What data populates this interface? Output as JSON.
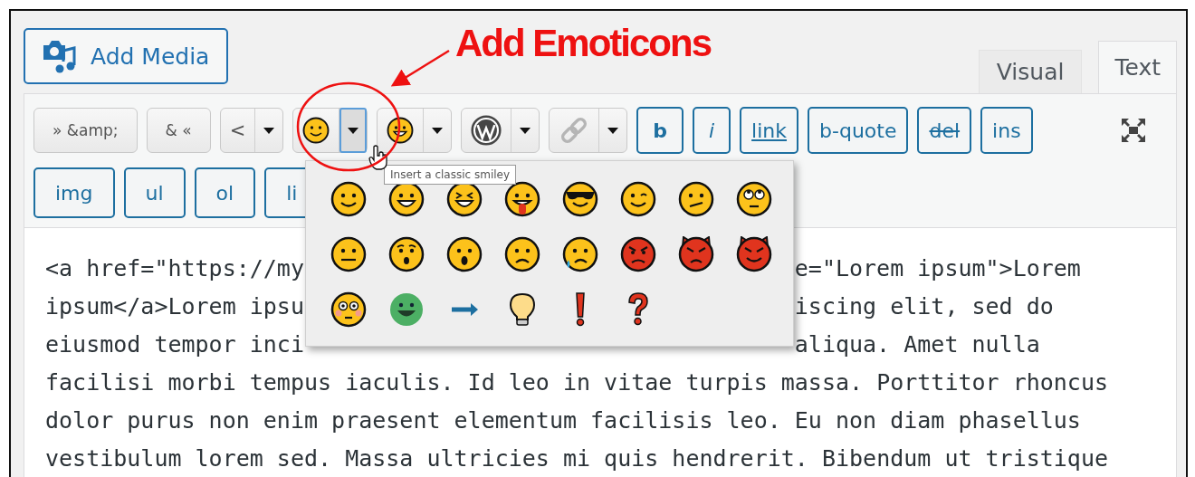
{
  "annotation": {
    "text": "Add Emoticons"
  },
  "add_media": {
    "label": "Add Media"
  },
  "tabs": [
    {
      "label": "Visual",
      "selected": false
    },
    {
      "label": "Text",
      "selected": true
    }
  ],
  "toolbar": {
    "row_1": [
      {
        "kind": "text",
        "label": "» &amp;"
      },
      {
        "kind": "text",
        "label": "& «"
      },
      {
        "kind": "split",
        "label": "<",
        "caret_active": false
      },
      {
        "kind": "smiley",
        "caret_active": true
      },
      {
        "kind": "grin",
        "caret_active": false
      },
      {
        "kind": "wp",
        "caret_active": false
      },
      {
        "kind": "chain",
        "caret_active": false
      },
      {
        "kind": "bold",
        "label": "b"
      },
      {
        "kind": "italic",
        "label": "i"
      },
      {
        "kind": "underline",
        "label": "link"
      },
      {
        "kind": "tag",
        "label": "b-quote"
      },
      {
        "kind": "strike",
        "label": "del"
      },
      {
        "kind": "tag",
        "label": "ins"
      }
    ],
    "row_2": [
      {
        "label": "img"
      },
      {
        "label": "ul"
      },
      {
        "label": "ol"
      },
      {
        "label": "li"
      }
    ]
  },
  "tooltip": "Insert a classic smiley",
  "smilies": [
    {
      "kind": "smile"
    },
    {
      "kind": "grin"
    },
    {
      "kind": "laugh"
    },
    {
      "kind": "tongue"
    },
    {
      "kind": "cool"
    },
    {
      "kind": "wink"
    },
    {
      "kind": "confused"
    },
    {
      "kind": "rolleyes"
    },
    {
      "kind": "neutral"
    },
    {
      "kind": "surprised"
    },
    {
      "kind": "eek"
    },
    {
      "kind": "sad"
    },
    {
      "kind": "cry"
    },
    {
      "kind": "mad"
    },
    {
      "kind": "evil"
    },
    {
      "kind": "twisted"
    },
    {
      "kind": "redface"
    },
    {
      "kind": "mrgreen"
    },
    {
      "kind": "arrow"
    },
    {
      "kind": "idea"
    },
    {
      "kind": "exclaim"
    },
    {
      "kind": "question"
    }
  ],
  "editor": {
    "lines": [
      {
        "left": "<a href=\"https://my",
        "right": "e=\"Lorem ipsum\">Lorem"
      },
      {
        "left": "ipsum</a>Lorem ipsu",
        "right": "iscing elit, sed do"
      },
      {
        "left": "eiusmod tempor inci",
        "right": "aliqua. Amet nulla"
      },
      {
        "left": "facilisi morbi tempus iaculis. Id leo in vitae turpis massa. Porttitor rhoncus"
      },
      {
        "left": "dolor purus non enim praesent elementum facilisis leo. Eu non diam phasellus"
      },
      {
        "left": "vestibulum lorem sed. Massa ultricies mi quis hendrerit. Bibendum ut tristique"
      }
    ]
  }
}
